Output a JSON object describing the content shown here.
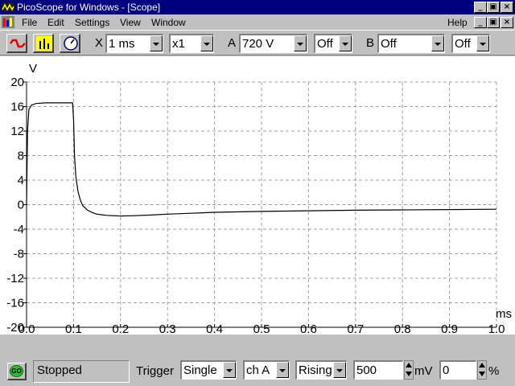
{
  "window": {
    "title": "PicoScope for Windows - [Scope]"
  },
  "menu": {
    "items": [
      "File",
      "Edit",
      "Settings",
      "View",
      "Window"
    ],
    "help": "Help"
  },
  "toolbar": {
    "x_label": "X",
    "timebase": "1 ms",
    "multiplier": "x1",
    "a_label": "A",
    "a_range": "720 V",
    "a_coupling": "Off",
    "b_label": "B",
    "b_range": "Off",
    "b_coupling": "Off",
    "buttons": [
      "scope-mode-icon",
      "spectrum-mode-icon",
      "meter-mode-icon"
    ]
  },
  "status": {
    "go_label": "GO",
    "state": "Stopped",
    "trigger_label": "Trigger",
    "trigger_mode": "Single",
    "trigger_channel": "ch A",
    "trigger_edge": "Rising",
    "trigger_level": "500",
    "trigger_level_unit": "mV",
    "pretrigger": "0",
    "pretrigger_unit": "%"
  },
  "chart_data": {
    "type": "line",
    "ylabel": "V",
    "xlabel": "ms",
    "xlim": [
      0.0,
      1.0
    ],
    "ylim": [
      -20,
      20
    ],
    "x_ticks": [
      "0.0",
      "0.1",
      "0.2",
      "0.3",
      "0.4",
      "0.5",
      "0.6",
      "0.7",
      "0.8",
      "0.9",
      "1.0"
    ],
    "y_ticks": [
      "20",
      "16",
      "12",
      "8",
      "4",
      "0",
      "-4",
      "-8",
      "-12",
      "-16",
      "-20"
    ],
    "grid": true,
    "line_color": "#000000",
    "series": [
      {
        "x": [
          0.0,
          0.002,
          0.005,
          0.01,
          0.02,
          0.04,
          0.06,
          0.08,
          0.098,
          0.1,
          0.102,
          0.105,
          0.11,
          0.115,
          0.12,
          0.13,
          0.14,
          0.15,
          0.17,
          0.2,
          0.23,
          0.26,
          0.3,
          0.35,
          0.4,
          0.5,
          0.6,
          0.7,
          0.8,
          0.9,
          1.0
        ],
        "y": [
          0.0,
          12.0,
          15.5,
          16.2,
          16.5,
          16.6,
          16.6,
          16.6,
          16.6,
          14.0,
          8.0,
          4.5,
          2.0,
          0.6,
          -0.2,
          -0.9,
          -1.3,
          -1.55,
          -1.75,
          -1.85,
          -1.8,
          -1.7,
          -1.55,
          -1.4,
          -1.25,
          -1.1,
          -1.0,
          -0.9,
          -0.85,
          -0.8,
          -0.75
        ]
      }
    ]
  }
}
